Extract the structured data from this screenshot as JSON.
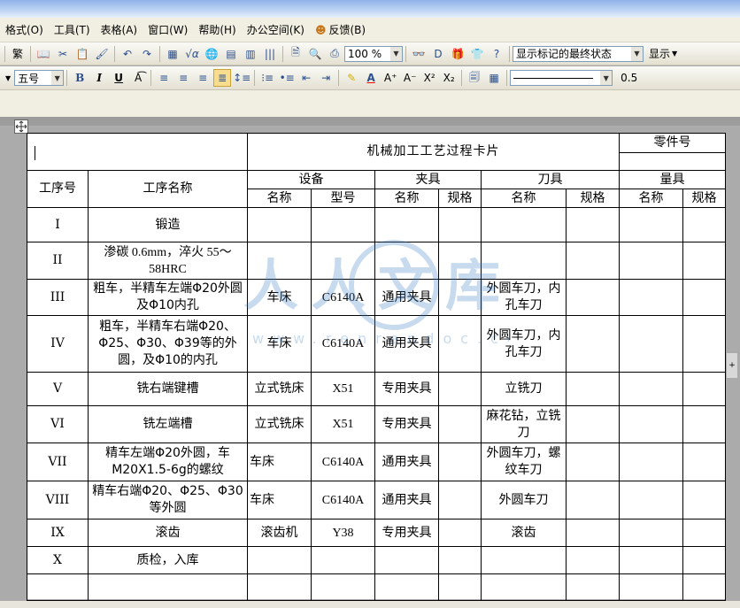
{
  "menubar": {
    "items": [
      "格式(O)",
      "工具(T)",
      "表格(A)",
      "窗口(W)",
      "帮助(H)",
      "办公空间(K)",
      "反馈(B)"
    ]
  },
  "toolbar1": {
    "trad_label": "繁",
    "zoom": "100 %",
    "markup_state": "显示标记的最终状态",
    "show_label": "显示"
  },
  "toolbar2": {
    "font_size": "五号",
    "bold": "B",
    "italic": "I",
    "underline": "U",
    "line_weight": "0.5"
  },
  "watermark": {
    "text": "人人文库",
    "url": "www.renrendoc.com"
  },
  "card": {
    "title": "机械加工工艺过程卡片",
    "part_no_label": "零件号",
    "headers": {
      "op_no": "工序号",
      "op_name": "工序名称",
      "equipment": "设备",
      "fixture": "夹具",
      "tool": "刀具",
      "gauge": "量具",
      "name": "名称",
      "model": "型号",
      "spec": "规格"
    },
    "rows": [
      {
        "no": "I",
        "name": "锻造",
        "eq_name": "",
        "eq_model": "",
        "fx_name": "",
        "fx_spec": "",
        "tool_name": "",
        "tool_spec": "",
        "gauge_name": "",
        "gauge_spec": ""
      },
      {
        "no": "II",
        "name": "渗碳 0.6mm，淬火 55～58HRC",
        "eq_name": "",
        "eq_model": "",
        "fx_name": "",
        "fx_spec": "",
        "tool_name": "",
        "tool_spec": "",
        "gauge_name": "",
        "gauge_spec": ""
      },
      {
        "no": "III",
        "name": "粗车，半精车左端Φ20外圆及Φ10内孔",
        "eq_name": "车床",
        "eq_model": "C6140A",
        "fx_name": "通用夹具",
        "fx_spec": "",
        "tool_name": "外圆车刀，内孔车刀",
        "tool_spec": "",
        "gauge_name": "",
        "gauge_spec": ""
      },
      {
        "no": "IV",
        "name": "粗车，半精车右端Φ20、Φ25、Φ30、Φ39等的外圆，及Φ10的内孔",
        "eq_name": "车床",
        "eq_model": "C6140A",
        "fx_name": "通用夹具",
        "fx_spec": "",
        "tool_name": "外圆车刀，内孔车刀",
        "tool_spec": "",
        "gauge_name": "",
        "gauge_spec": ""
      },
      {
        "no": "V",
        "name": "铣右端键槽",
        "eq_name": "立式铣床",
        "eq_model": "X51",
        "fx_name": "专用夹具",
        "fx_spec": "",
        "tool_name": "立铣刀",
        "tool_spec": "",
        "gauge_name": "",
        "gauge_spec": ""
      },
      {
        "no": "VI",
        "name": "铣左端槽",
        "eq_name": "立式铣床",
        "eq_model": "X51",
        "fx_name": "专用夹具",
        "fx_spec": "",
        "tool_name": "麻花钻，立铣刀",
        "tool_spec": "",
        "gauge_name": "",
        "gauge_spec": ""
      },
      {
        "no": "VII",
        "name": "精车左端Φ20外圆，车M20X1.5-6g的螺纹",
        "eq_name": "车床",
        "eq_model": "C6140A",
        "fx_name": "通用夹具",
        "fx_spec": "",
        "tool_name": "外圆车刀，螺纹车刀",
        "tool_spec": "",
        "gauge_name": "",
        "gauge_spec": ""
      },
      {
        "no": "VIII",
        "name": "精车右端Φ20、Φ25、Φ30等外圆",
        "eq_name": "车床",
        "eq_model": "C6140A",
        "fx_name": "通用夹具",
        "fx_spec": "",
        "tool_name": "外圆车刀",
        "tool_spec": "",
        "gauge_name": "",
        "gauge_spec": ""
      },
      {
        "no": "IX",
        "name": "滚齿",
        "eq_name": "滚齿机",
        "eq_model": "Y38",
        "fx_name": "专用夹具",
        "fx_spec": "",
        "tool_name": "滚齿",
        "tool_spec": "",
        "gauge_name": "",
        "gauge_spec": ""
      },
      {
        "no": "X",
        "name": "质检，入库",
        "eq_name": "",
        "eq_model": "",
        "fx_name": "",
        "fx_spec": "",
        "tool_name": "",
        "tool_spec": "",
        "gauge_name": "",
        "gauge_spec": ""
      },
      {
        "no": "",
        "name": "",
        "eq_name": "",
        "eq_model": "",
        "fx_name": "",
        "fx_spec": "",
        "tool_name": "",
        "tool_spec": "",
        "gauge_name": "",
        "gauge_spec": ""
      }
    ]
  }
}
